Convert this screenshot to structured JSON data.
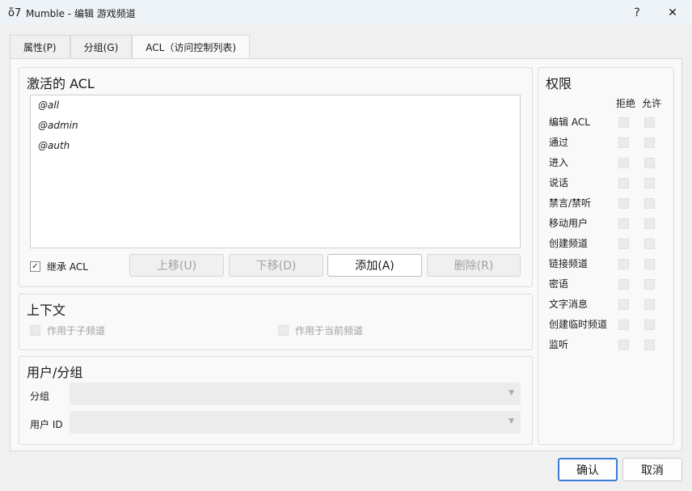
{
  "window": {
    "title": "Mumble - 编辑 游戏频道",
    "help": "?",
    "close": "✕",
    "icon": "mumble-logo"
  },
  "tabs": [
    {
      "label": "属性(P)"
    },
    {
      "label": "分组(G)"
    },
    {
      "label": "ACL（访问控制列表)"
    }
  ],
  "active_acl": {
    "title": "激活的 ACL",
    "entries": [
      "@all",
      "@admin",
      "@auth"
    ],
    "inherit_label": "继承 ACL",
    "inherit_checked": true,
    "up": "上移(U)",
    "down": "下移(D)",
    "add": "添加(A)",
    "remove": "删除(R)"
  },
  "context": {
    "title": "上下文",
    "sub": "作用于子频道",
    "current": "作用于当前频道"
  },
  "user_group": {
    "title": "用户/分组",
    "group_label": "分组",
    "user_label": "用户 ID",
    "group_value": "",
    "user_value": ""
  },
  "permissions": {
    "title": "权限",
    "deny": "拒绝",
    "allow": "允许",
    "items": [
      "编辑 ACL",
      "通过",
      "进入",
      "说话",
      "禁言/禁听",
      "移动用户",
      "创建频道",
      "链接频道",
      "密语",
      "文字消息",
      "创建临时频道",
      "监听"
    ]
  },
  "footer": {
    "ok": "确认",
    "cancel": "取消"
  }
}
